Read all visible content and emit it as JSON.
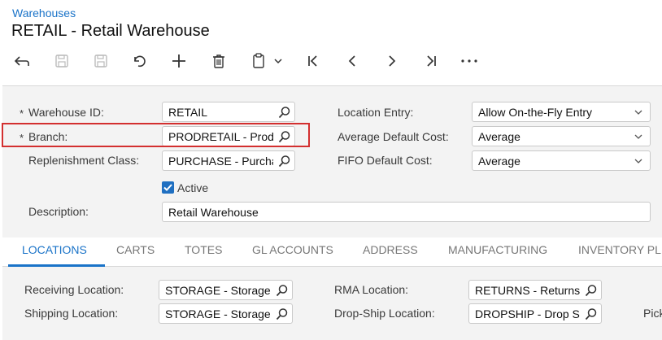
{
  "breadcrumb": "Warehouses",
  "title": "RETAIL - Retail Warehouse",
  "toolbar": {
    "icons": [
      "back-icon",
      "save-close-icon",
      "save-icon",
      "undo-icon",
      "add-icon",
      "delete-icon",
      "copy-paste-icon",
      "chevron-down-icon",
      "first-record-icon",
      "previous-icon",
      "next-icon",
      "last-record-icon",
      "more-icon"
    ]
  },
  "form": {
    "warehouse_id": {
      "label": "Warehouse ID:",
      "value": "RETAIL",
      "required": "*"
    },
    "branch": {
      "label": "Branch:",
      "value": "PRODRETAIL - Prod",
      "required": "*"
    },
    "replenishment_class": {
      "label": "Replenishment Class:",
      "value": "PURCHASE - Purcha"
    },
    "active": {
      "label": "Active",
      "checked": true
    },
    "description": {
      "label": "Description:",
      "value": "Retail Warehouse"
    },
    "location_entry": {
      "label": "Location Entry:",
      "value": "Allow On-the-Fly Entry"
    },
    "average_default_cost": {
      "label": "Average Default Cost:",
      "value": "Average"
    },
    "fifo_default_cost": {
      "label": "FIFO Default Cost:",
      "value": "Average"
    }
  },
  "tabs": [
    {
      "label": "LOCATIONS",
      "active": true
    },
    {
      "label": "CARTS",
      "active": false
    },
    {
      "label": "TOTES",
      "active": false
    },
    {
      "label": "GL ACCOUNTS",
      "active": false
    },
    {
      "label": "ADDRESS",
      "active": false
    },
    {
      "label": "MANUFACTURING",
      "active": false
    },
    {
      "label": "INVENTORY PL",
      "active": false
    }
  ],
  "locations": {
    "receiving": {
      "label": "Receiving Location:",
      "value": "STORAGE - Storage"
    },
    "shipping": {
      "label": "Shipping Location:",
      "value": "STORAGE - Storage"
    },
    "rma": {
      "label": "RMA Location:",
      "value": "RETURNS - Returns"
    },
    "drop_ship": {
      "label": "Drop-Ship Location:",
      "value": "DROPSHIP - Drop S"
    },
    "cut_label": "Pick"
  },
  "colors": {
    "accent": "#1a73c8",
    "highlight": "#d32f2f",
    "panel": "#f3f3f3"
  }
}
